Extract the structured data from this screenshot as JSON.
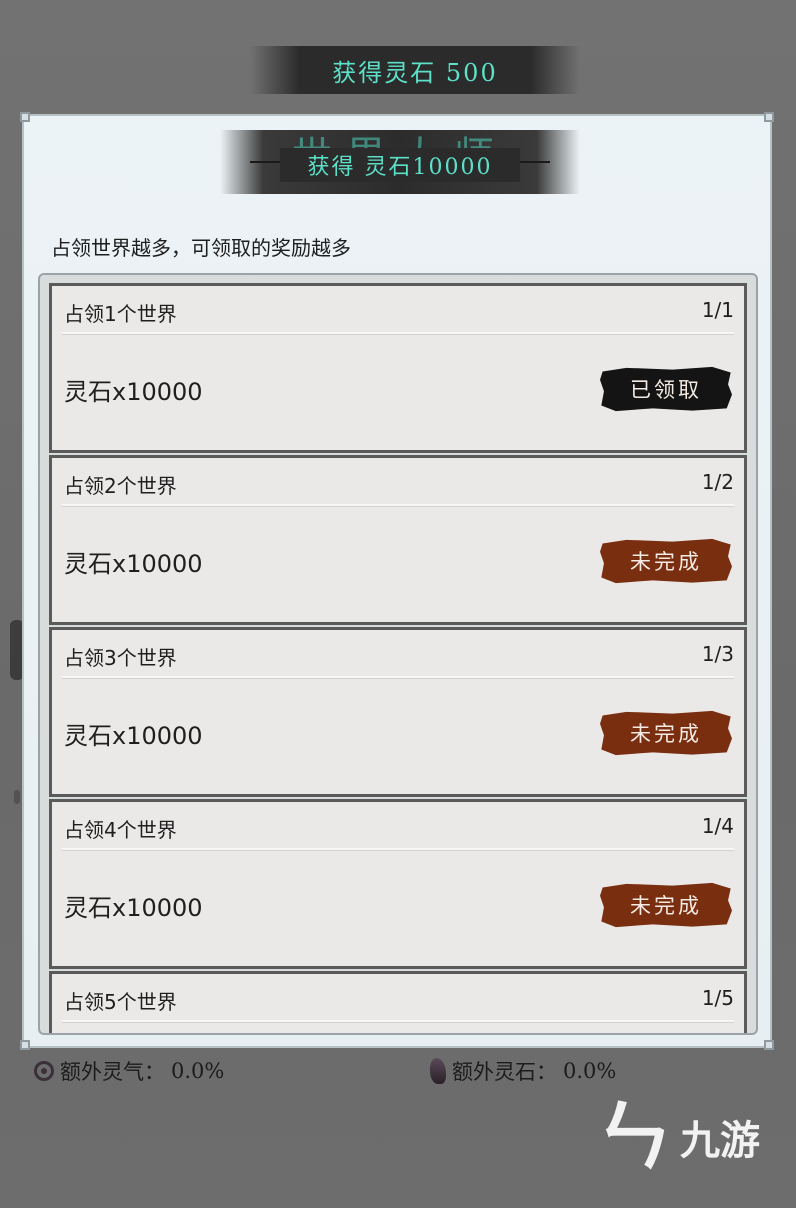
{
  "toasts": {
    "top": "获得灵石 500",
    "middle": "获得 灵石10000"
  },
  "panel": {
    "title_ghost": "世界大师",
    "subtitle": "占领世界越多，可领取的奖励越多"
  },
  "rewards": [
    {
      "title": "占领1个世界",
      "progress": "1/1",
      "reward": "灵石x10000",
      "button": "已领取",
      "state": "claimed"
    },
    {
      "title": "占领2个世界",
      "progress": "1/2",
      "reward": "灵石x10000",
      "button": "未完成",
      "state": "incomplete"
    },
    {
      "title": "占领3个世界",
      "progress": "1/3",
      "reward": "灵石x10000",
      "button": "未完成",
      "state": "incomplete"
    },
    {
      "title": "占领4个世界",
      "progress": "1/4",
      "reward": "灵石x10000",
      "button": "未完成",
      "state": "incomplete"
    },
    {
      "title": "占领5个世界",
      "progress": "1/5",
      "reward": "",
      "button": "",
      "state": "incomplete"
    }
  ],
  "stats": {
    "extra_qi_label": "额外灵气：",
    "extra_qi_value": "0.0%",
    "extra_stone_label": "额外灵石：",
    "extra_stone_value": "0.0%"
  },
  "watermark": {
    "mark": "ㄣ",
    "text": "九游"
  },
  "colors": {
    "toast_text": "#5de0c8",
    "claimed_button": "#141414",
    "incomplete_button": "#7a2e10"
  }
}
